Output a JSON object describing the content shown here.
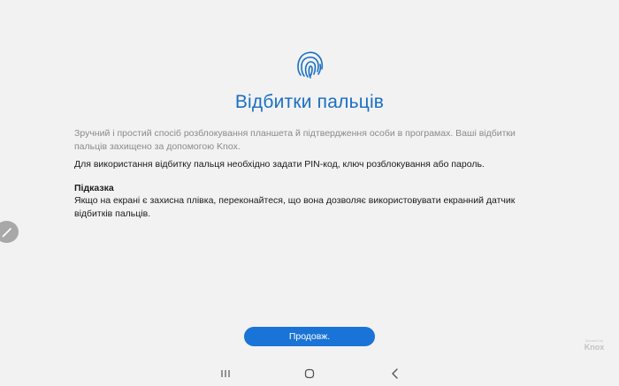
{
  "setup": {
    "title": "Відбитки пальців",
    "description_muted": "Зручний і простий спосіб розблокування планшета й підтвердження особи в програмах. Ваші відбитки пальців захищено за допомогою Knox.",
    "description_main": "Для використання відбитку пальця необхідно задати PIN-код, ключ розблокування або пароль.",
    "hint_title": "Підказка",
    "hint_body": "Якщо на екрані є захисна плівка, переконайтеся, що вона дозволяє використовувати екранний датчик відбитків пальців.",
    "continue_label": "Продовж."
  },
  "knox_badge": {
    "small_text": "Secured by",
    "brand": "Knox"
  },
  "icons": {
    "header": "fingerprint-icon",
    "edge_panel": "pencil-icon",
    "nav_recents": "recents-icon",
    "nav_home": "home-icon",
    "nav_back": "back-icon"
  },
  "colors": {
    "accent": "#1a73d6",
    "title": "#1a6fc4",
    "background": "#f2f2f2",
    "muted_text": "#8a8a8a"
  }
}
